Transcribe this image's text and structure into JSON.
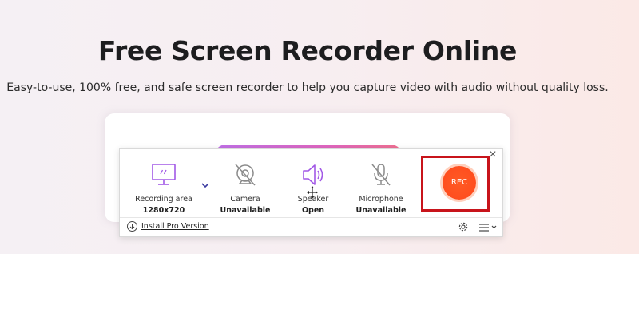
{
  "page": {
    "title": "Free Screen Recorder Online",
    "subtitle": "Easy-to-use, 100% free, and safe screen recorder to help you capture video with audio without quality loss."
  },
  "recorder": {
    "tools": [
      {
        "label": "Recording area",
        "value": "1280x720",
        "icon": "monitor-icon"
      },
      {
        "label": "Camera",
        "value": "Unavailable",
        "icon": "camera-off-icon"
      },
      {
        "label": "Speaker",
        "value": "Open",
        "icon": "speaker-icon"
      },
      {
        "label": "Microphone",
        "value": "Unavailable",
        "icon": "microphone-off-icon"
      }
    ],
    "rec_label": "REC",
    "install_label": "Install Pro Version",
    "close_symbol": "×"
  },
  "colors": {
    "accent_purple": "#a259e6",
    "rec_orange": "#ff4e1e",
    "highlight_red": "#c8141b"
  }
}
